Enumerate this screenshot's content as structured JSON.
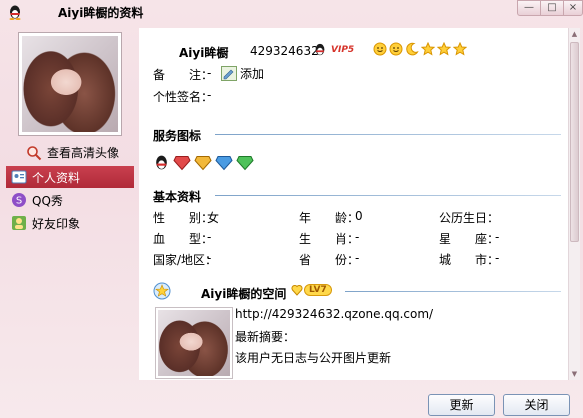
{
  "window": {
    "title": "Aiyi眸橱的资料",
    "min": "—",
    "max": "□",
    "close": "×"
  },
  "left": {
    "hd_link": "查看高清头像",
    "nav": [
      {
        "label": "个人资料",
        "active": true
      },
      {
        "label": "QQ秀",
        "active": false
      },
      {
        "label": "好友印象",
        "active": false
      }
    ]
  },
  "profile": {
    "nickname": "Aiyi眸橱",
    "qq": "429324632",
    "vip": "VIP5",
    "note_label": "备　　注：",
    "note_value": "-",
    "add_label": "添加",
    "signature_label": "个性签名：",
    "signature_value": "-"
  },
  "services": {
    "title": "服务图标"
  },
  "basic": {
    "title": "基本资料",
    "fields": {
      "gender_label": "性　　别：",
      "gender": "女",
      "age_label": "年　　龄：",
      "age": "0",
      "birthday_label": "公历生日：",
      "birthday": "",
      "blood_label": "血　　型：",
      "blood": "-",
      "zodiac_label": "生　　肖：",
      "zodiac": "-",
      "constellation_label": "星　　座：",
      "constellation": "-",
      "country_label": "国家/地区：",
      "country": "-",
      "province_label": "省　　份：",
      "province": "-",
      "city_label": "城　　市：",
      "city": "-"
    }
  },
  "space": {
    "title": "Aiyi眸橱的空间",
    "level": "LV7",
    "url": "http://429324632.qzone.qq.com/",
    "summary_label": "最新摘要：",
    "summary": "该用户无日志与公开图片更新"
  },
  "buttons": {
    "refresh": "更新",
    "close": "关闭"
  },
  "colors": {
    "nav_active": "#b8323f",
    "section_line": "#7ea3c9",
    "title_bg": "#f6e4e8"
  }
}
